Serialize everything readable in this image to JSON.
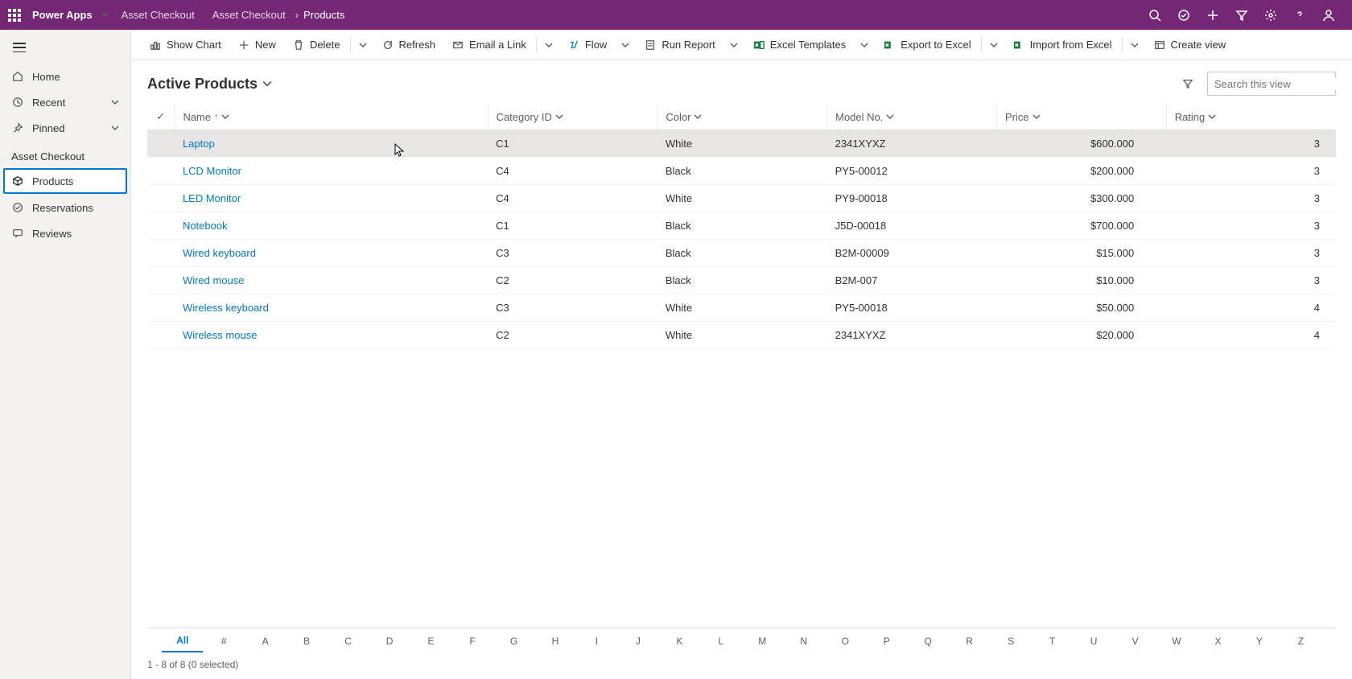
{
  "header": {
    "app_name": "Power Apps",
    "breadcrumb1": "Asset Checkout",
    "breadcrumb2": "Asset Checkout",
    "breadcrumb3": "Products"
  },
  "sidebar": {
    "items": [
      {
        "label": "Home"
      },
      {
        "label": "Recent"
      },
      {
        "label": "Pinned"
      }
    ],
    "section": "Asset Checkout",
    "section_items": [
      {
        "label": "Products"
      },
      {
        "label": "Reservations"
      },
      {
        "label": "Reviews"
      }
    ]
  },
  "commands": {
    "show_chart": "Show Chart",
    "new": "New",
    "delete": "Delete",
    "refresh": "Refresh",
    "email": "Email a Link",
    "flow": "Flow",
    "run_report": "Run Report",
    "excel_templates": "Excel Templates",
    "export_excel": "Export to Excel",
    "import_excel": "Import from Excel",
    "create_view": "Create view"
  },
  "view": {
    "title": "Active Products",
    "search_placeholder": "Search this view"
  },
  "table": {
    "columns": [
      "Name",
      "Category ID",
      "Color",
      "Model No.",
      "Price",
      "Rating"
    ],
    "rows": [
      {
        "name": "Laptop",
        "cat": "C1",
        "color": "White",
        "model": "2341XYXZ",
        "price": "$600.000",
        "rating": "3"
      },
      {
        "name": "LCD Monitor",
        "cat": "C4",
        "color": "Black",
        "model": "PY5-00012",
        "price": "$200.000",
        "rating": "3"
      },
      {
        "name": "LED Monitor",
        "cat": "C4",
        "color": "White",
        "model": "PY9-00018",
        "price": "$300.000",
        "rating": "3"
      },
      {
        "name": "Notebook",
        "cat": "C1",
        "color": "Black",
        "model": "J5D-00018",
        "price": "$700.000",
        "rating": "3"
      },
      {
        "name": "Wired keyboard",
        "cat": "C3",
        "color": "Black",
        "model": "B2M-00009",
        "price": "$15.000",
        "rating": "3"
      },
      {
        "name": "Wired mouse",
        "cat": "C2",
        "color": "Black",
        "model": "B2M-007",
        "price": "$10.000",
        "rating": "3"
      },
      {
        "name": "Wireless keyboard",
        "cat": "C3",
        "color": "White",
        "model": "PY5-00018",
        "price": "$50.000",
        "rating": "4"
      },
      {
        "name": "Wireless mouse",
        "cat": "C2",
        "color": "White",
        "model": "2341XYXZ",
        "price": "$20.000",
        "rating": "4"
      }
    ]
  },
  "alpha": [
    "All",
    "#",
    "A",
    "B",
    "C",
    "D",
    "E",
    "F",
    "G",
    "H",
    "I",
    "J",
    "K",
    "L",
    "M",
    "N",
    "O",
    "P",
    "Q",
    "R",
    "S",
    "T",
    "U",
    "V",
    "W",
    "X",
    "Y",
    "Z"
  ],
  "status": "1 - 8 of 8 (0 selected)"
}
